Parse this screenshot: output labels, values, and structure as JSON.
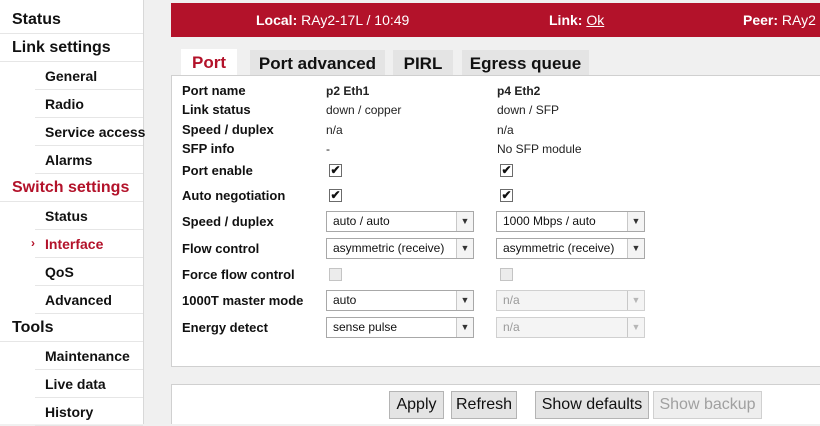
{
  "sidebar": {
    "status": "Status",
    "link_settings": "Link settings",
    "link_items": [
      "General",
      "Radio",
      "Service access",
      "Alarms"
    ],
    "switch_settings": "Switch settings",
    "switch_items": [
      "Status",
      "Interface",
      "QoS",
      "Advanced"
    ],
    "tools": "Tools",
    "tools_items": [
      "Maintenance",
      "Live data",
      "History"
    ]
  },
  "header": {
    "local_label": "Local:",
    "local_value": "RAy2-17L / 10:49",
    "link_label": "Link:",
    "link_value": "Ok",
    "peer_label": "Peer:",
    "peer_value": "RAy2"
  },
  "tabs": [
    "Port",
    "Port advanced",
    "PIRL",
    "Egress queue"
  ],
  "form": {
    "labels": {
      "port_name": "Port name",
      "link_status": "Link status",
      "speed_duplex_info": "Speed / duplex",
      "sfp_info": "SFP info",
      "port_enable": "Port enable",
      "auto_negotiation": "Auto negotiation",
      "speed_duplex": "Speed / duplex",
      "flow_control": "Flow control",
      "force_flow_control": "Force flow control",
      "master_mode": "1000T master mode",
      "energy_detect": "Energy detect"
    },
    "p2": {
      "name": "p2 Eth1",
      "link_status": "down / copper",
      "speed_duplex_info": "n/a",
      "sfp_info": "-",
      "port_enable": "✔",
      "auto_negotiation": "✔",
      "speed_duplex": "auto / auto",
      "flow_control": "asymmetric (receive)",
      "master_mode": "auto",
      "energy_detect": "sense pulse"
    },
    "p4": {
      "name": "p4 Eth2",
      "link_status": "down / SFP",
      "speed_duplex_info": "n/a",
      "sfp_info": "No SFP module",
      "port_enable": "✔",
      "auto_negotiation": "✔",
      "speed_duplex": "1000 Mbps / auto",
      "flow_control": "asymmetric (receive)",
      "master_mode": "n/a",
      "energy_detect": "n/a"
    }
  },
  "buttons": {
    "apply": "Apply",
    "refresh": "Refresh",
    "show_defaults": "Show defaults",
    "show_backup": "Show backup"
  },
  "icons": {
    "dropdown": "▼",
    "active_arrow": "›"
  },
  "colors": {
    "accent": "#b3122a",
    "header_text": "#ffffff"
  }
}
